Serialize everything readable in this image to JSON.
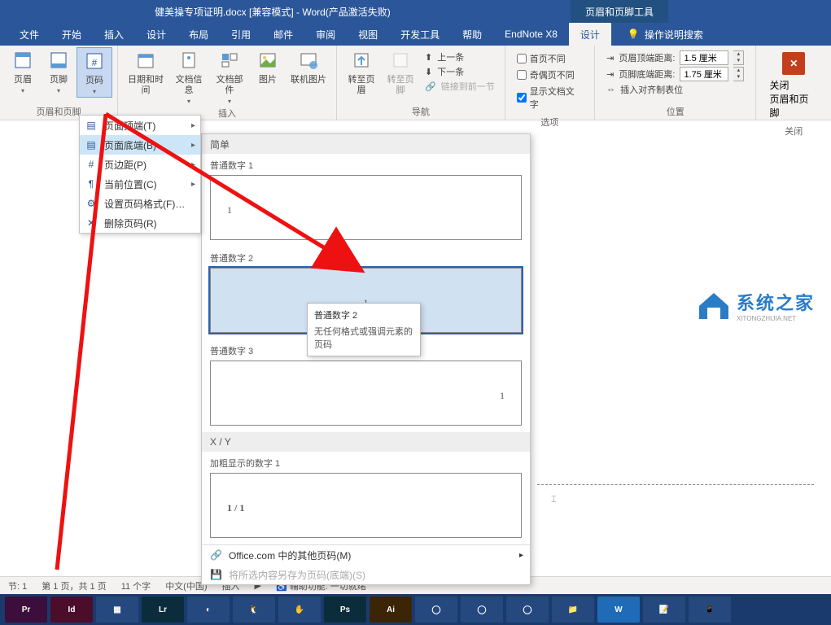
{
  "title": "健美操专项证明.docx [兼容模式] - Word(产品激活失败)",
  "context_title": "页眉和页脚工具",
  "tabs": [
    "文件",
    "开始",
    "插入",
    "设计",
    "布局",
    "引用",
    "邮件",
    "审阅",
    "视图",
    "开发工具",
    "帮助",
    "EndNote X8",
    "设计"
  ],
  "tell_me": "操作说明搜索",
  "group_header_footer": {
    "label": "页眉和页脚",
    "items": {
      "header": "页眉",
      "footer": "页脚",
      "page_number": "页码"
    }
  },
  "group_insert": {
    "label": "插入",
    "items": {
      "date": "日期和时间",
      "docinfo": "文档信息",
      "docpart": "文档部件",
      "picture": "图片",
      "online_picture": "联机图片"
    }
  },
  "group_nav": {
    "label": "导航",
    "goto_header": "转至页眉",
    "goto_footer": "转至页脚",
    "prev": "上一条",
    "next": "下一条",
    "link_prev": "链接到前一节"
  },
  "group_options": {
    "label": "选项",
    "diff_first": "首页不同",
    "diff_oddeven": "奇偶页不同",
    "show_doc_text": "显示文档文字",
    "show_doc_text_checked": true
  },
  "group_position": {
    "label": "位置",
    "header_dist": "页眉顶端距离:",
    "footer_dist": "页脚底端距离:",
    "header_val": "1.5 厘米",
    "footer_val": "1.75 厘米",
    "insert_tab": "插入对齐制表位"
  },
  "group_close": {
    "label": "关闭",
    "btn": "关闭\n页眉和页脚"
  },
  "dropdown": {
    "items": [
      {
        "label": "页面顶端(T)",
        "icon": "▤",
        "sub": true
      },
      {
        "label": "页面底端(B)",
        "icon": "▤",
        "sub": true,
        "hover": true
      },
      {
        "label": "页边距(P)",
        "icon": "#",
        "sub": true
      },
      {
        "label": "当前位置(C)",
        "icon": "¶",
        "sub": true
      },
      {
        "label": "设置页码格式(F)…",
        "icon": "⚙"
      },
      {
        "label": "删除页码(R)",
        "icon": "✕"
      }
    ]
  },
  "gallery": {
    "heading": "简单",
    "items": [
      {
        "label": "普通数字 1",
        "num": "1",
        "align": "left"
      },
      {
        "label": "普通数字 2",
        "num": "1",
        "align": "center",
        "selected": true
      },
      {
        "label": "普通数字 3",
        "num": "1",
        "align": "right"
      }
    ],
    "section2": "X / Y",
    "item2": {
      "label": "加粗显示的数字 1",
      "num": "1 / 1",
      "align": "left"
    },
    "office_more": "Office.com 中的其他页码(M)",
    "save_sel": "将所选内容另存为页码(底端)(S)"
  },
  "tooltip": {
    "title": "普通数字 2",
    "body": "无任何格式或强调元素的页码"
  },
  "watermark": {
    "title": "系统之家",
    "sub": "XITONGZHIJIA.NET"
  },
  "status": {
    "section": "节: 1",
    "page": "第 1 页，共 1 页",
    "words": "11 个字",
    "lang": "中文(中国)",
    "mode": "插入",
    "access": "辅助功能: 一切就绪"
  },
  "taskbar": [
    "Pr",
    "Id",
    "▦",
    "Lr",
    "◐",
    "🐧",
    "✋",
    "Ps",
    "Ai",
    "◯",
    "◯",
    "◯",
    "📁",
    "W",
    "📝",
    "📱"
  ]
}
